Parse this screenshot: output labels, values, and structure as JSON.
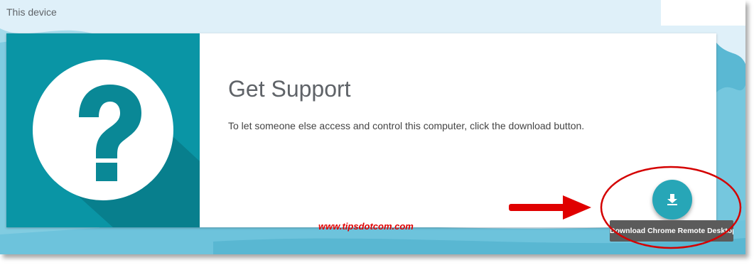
{
  "section": {
    "title": "This device"
  },
  "support_card": {
    "heading": "Get Support",
    "description": "To let someone else access and control this computer, click the download button.",
    "hero_icon": "question-mark-icon"
  },
  "download": {
    "icon": "download-icon",
    "tooltip": "Download Chrome Remote Desktop"
  },
  "annotation": {
    "watermark": "www.tipsdotcom.com",
    "arrow_color": "#e00000",
    "circle_color": "#d40000"
  },
  "colors": {
    "accent": "#0a95a5",
    "fab": "#27a6b7",
    "background": "#dff0f9"
  }
}
